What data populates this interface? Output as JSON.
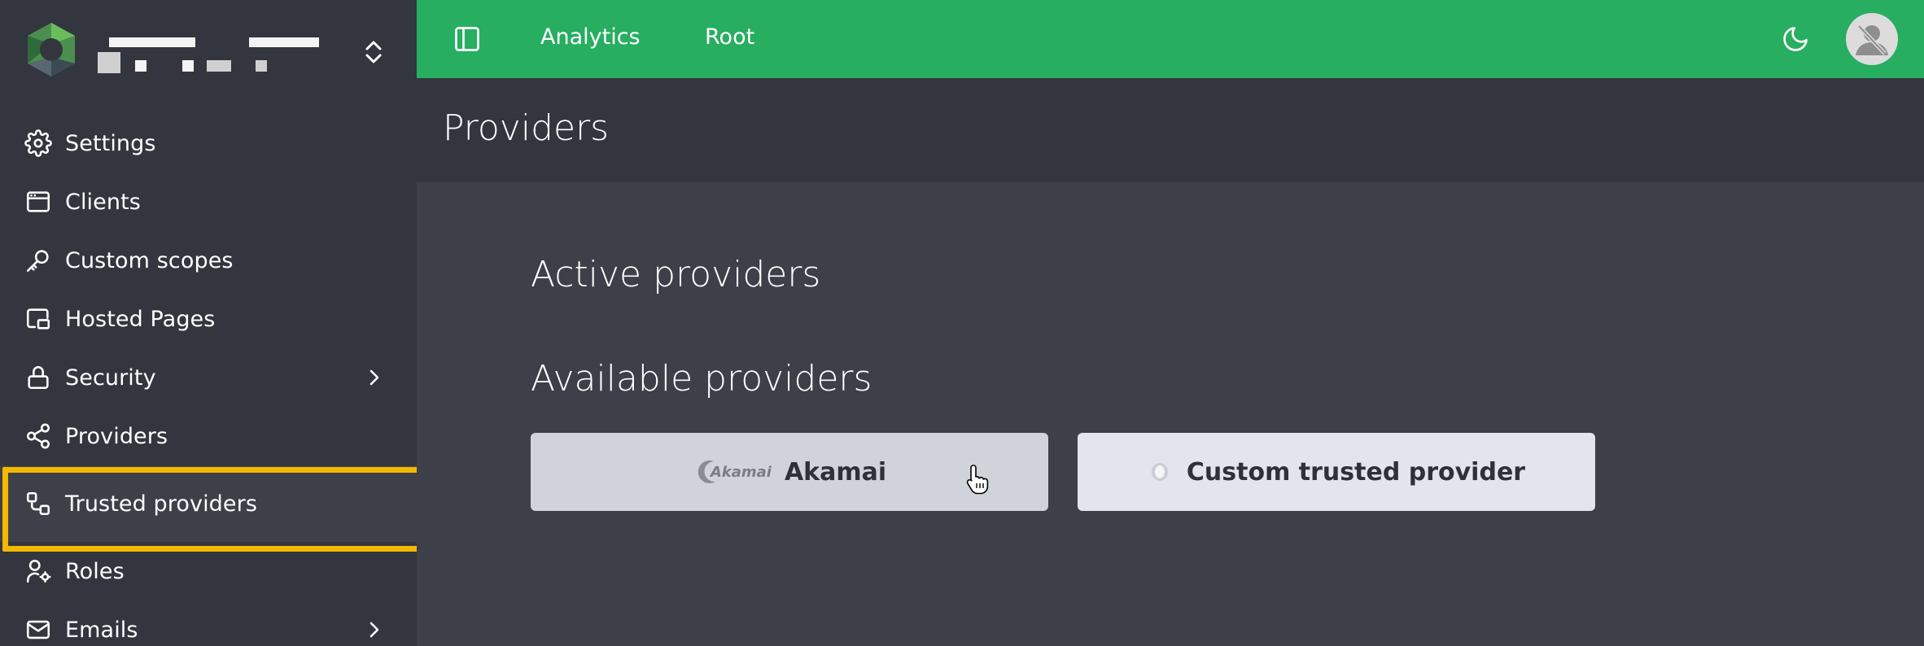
{
  "sidebar": {
    "items": [
      {
        "label": "Settings",
        "icon": "gear-icon",
        "has_chevron": false
      },
      {
        "label": "Clients",
        "icon": "browser-window-icon",
        "has_chevron": false
      },
      {
        "label": "Custom scopes",
        "icon": "key-icon",
        "has_chevron": false
      },
      {
        "label": "Hosted Pages",
        "icon": "hosted-pages-icon",
        "has_chevron": false
      },
      {
        "label": "Security",
        "icon": "lock-icon",
        "has_chevron": true
      },
      {
        "label": "Providers",
        "icon": "share-nodes-icon",
        "has_chevron": false
      },
      {
        "label": "Trusted providers",
        "icon": "trusted-providers-icon",
        "has_chevron": false,
        "active": true
      },
      {
        "label": "Roles",
        "icon": "user-gear-icon",
        "has_chevron": false
      },
      {
        "label": "Emails",
        "icon": "envelope-icon",
        "has_chevron": true
      }
    ]
  },
  "topbar": {
    "links": [
      "Analytics",
      "Root"
    ],
    "color": "#27ae60"
  },
  "page": {
    "title": "Providers"
  },
  "main": {
    "active_title": "Active providers",
    "available_title": "Available providers",
    "providers": [
      {
        "label": "Akamai",
        "logo_text": "Akamai"
      },
      {
        "label": "Custom trusted provider"
      }
    ]
  },
  "colors": {
    "highlight": "#f5b800",
    "sidebar": "#33363e",
    "content": "#3d4048"
  }
}
